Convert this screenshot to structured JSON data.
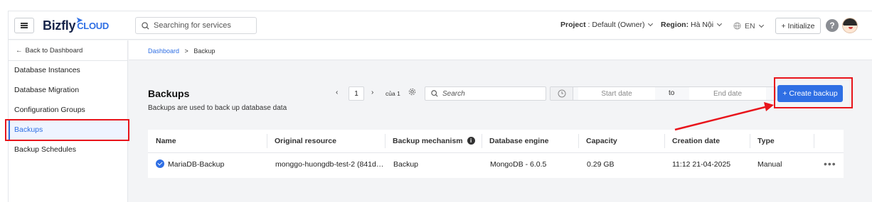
{
  "header": {
    "brand": "Bizfly",
    "brand_suffix": "CLOUD",
    "search_placeholder": "Searching for services",
    "project_label": "Project",
    "project_value": " : Default (Owner)",
    "region_label": "Region:",
    "region_value": " Hà Nội",
    "language": "EN",
    "initialize": "+ Initialize",
    "help": "?"
  },
  "sidebar": {
    "back": "Back to Dashboard",
    "items": [
      {
        "label": "Database Instances"
      },
      {
        "label": "Database Migration"
      },
      {
        "label": "Configuration Groups"
      },
      {
        "label": "Backups"
      },
      {
        "label": "Backup Schedules"
      }
    ]
  },
  "breadcrumb": {
    "root": "Dashboard",
    "sep": ">",
    "current": "Backup"
  },
  "main": {
    "title": "Backups",
    "subtitle": "Backups are used to back up database data",
    "pager": {
      "page": "1",
      "of_label": "của 1"
    },
    "search_placeholder": "Search",
    "start_date": "Start date",
    "to": "to",
    "end_date": "End date",
    "create_button": "+ Create backup"
  },
  "table": {
    "columns": [
      "Name",
      "Original resource",
      "Backup mechanism",
      "Database engine",
      "Capacity",
      "Creation date",
      "Type"
    ],
    "rows": [
      {
        "name": "MariaDB-Backup",
        "resource": "monggo-huongdb-test-2 (841d…",
        "mechanism": "Backup",
        "engine": "MongoDB - 6.0.5",
        "capacity": "0.29 GB",
        "created": "11:12 21-04-2025",
        "type": "Manual",
        "more": "•••"
      }
    ]
  },
  "colors": {
    "accent": "#2f6fe4",
    "annotation": "#e8141b"
  }
}
